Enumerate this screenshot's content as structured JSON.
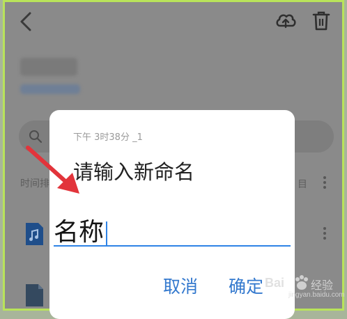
{
  "background": {
    "folder_title_blurred": "",
    "folder_subtitle_blurred": "",
    "sort_label": "时间排",
    "sort_glyph": "目"
  },
  "dialog": {
    "subtitle": "下午 3时38分 _1",
    "title": "请输入新命名",
    "input_value": "名称",
    "cancel_label": "取消",
    "confirm_label": "确定"
  },
  "watermark": {
    "brand": "Bai",
    "cn_label": "经验",
    "url": "jingyan.baidu.com"
  },
  "colors": {
    "frame": "#b9e35a",
    "accent_blue": "#2e83e6",
    "arrow_red": "#e2343b",
    "overlay_gray": "#8a8a8a"
  },
  "icons": {
    "back": "chevron-left-icon",
    "cloud": "cloud-upload-icon",
    "trash": "trash-icon",
    "search": "search-icon",
    "music": "music-file-icon",
    "document": "document-file-icon",
    "more": "more-vertical-icon"
  }
}
